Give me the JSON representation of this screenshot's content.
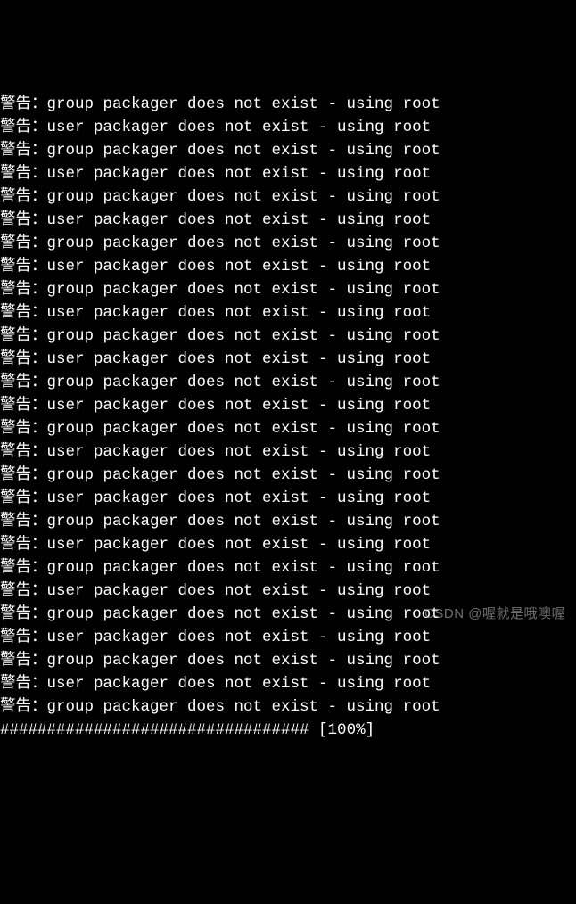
{
  "terminal": {
    "warning_prefix": "警告：",
    "group_msg": "group packager does not exist - using root",
    "user_msg": "user packager does not exist - using root",
    "lines": [
      {
        "prefix": "警告：",
        "msg": "group packager does not exist - using root"
      },
      {
        "prefix": "警告：",
        "msg": "user packager does not exist - using root"
      },
      {
        "prefix": "警告：",
        "msg": "group packager does not exist - using root"
      },
      {
        "prefix": "警告：",
        "msg": "user packager does not exist - using root"
      },
      {
        "prefix": "警告：",
        "msg": "group packager does not exist - using root"
      },
      {
        "prefix": "警告：",
        "msg": "user packager does not exist - using root"
      },
      {
        "prefix": "警告：",
        "msg": "group packager does not exist - using root"
      },
      {
        "prefix": "警告：",
        "msg": "user packager does not exist - using root"
      },
      {
        "prefix": "警告：",
        "msg": "group packager does not exist - using root"
      },
      {
        "prefix": "警告：",
        "msg": "user packager does not exist - using root"
      },
      {
        "prefix": "警告：",
        "msg": "group packager does not exist - using root"
      },
      {
        "prefix": "警告：",
        "msg": "user packager does not exist - using root"
      },
      {
        "prefix": "警告：",
        "msg": "group packager does not exist - using root"
      },
      {
        "prefix": "警告：",
        "msg": "user packager does not exist - using root"
      },
      {
        "prefix": "警告：",
        "msg": "group packager does not exist - using root"
      },
      {
        "prefix": "警告：",
        "msg": "user packager does not exist - using root"
      },
      {
        "prefix": "警告：",
        "msg": "group packager does not exist - using root"
      },
      {
        "prefix": "警告：",
        "msg": "user packager does not exist - using root"
      },
      {
        "prefix": "警告：",
        "msg": "group packager does not exist - using root"
      },
      {
        "prefix": "警告：",
        "msg": "user packager does not exist - using root"
      },
      {
        "prefix": "警告：",
        "msg": "group packager does not exist - using root"
      },
      {
        "prefix": "警告：",
        "msg": "user packager does not exist - using root"
      },
      {
        "prefix": "警告：",
        "msg": "group packager does not exist - using root"
      },
      {
        "prefix": "警告：",
        "msg": "user packager does not exist - using root"
      },
      {
        "prefix": "警告：",
        "msg": "group packager does not exist - using root"
      },
      {
        "prefix": "警告：",
        "msg": "user packager does not exist - using root"
      },
      {
        "prefix": "警告：",
        "msg": "group packager does not exist - using root"
      }
    ],
    "progress_line": "################################# [100%]"
  },
  "watermark": "CSDN @喔就是哦噢喔"
}
